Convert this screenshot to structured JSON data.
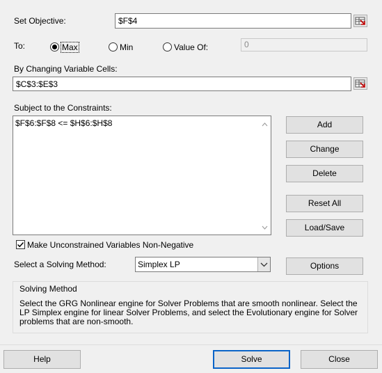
{
  "objective": {
    "label": "Set Objective:",
    "mnemonic": "b",
    "value": "$F$4"
  },
  "to": {
    "label": "To:",
    "options": [
      {
        "label": "Max",
        "selected": true
      },
      {
        "label": "Min",
        "selected": false
      },
      {
        "label": "Value Of:",
        "selected": false
      }
    ],
    "value_of": "0"
  },
  "variables": {
    "label": "By Changing Variable Cells:",
    "value": "$C$3:$E$3"
  },
  "constraints": {
    "label": "Subject to the Constraints:",
    "items": [
      "$F$6:$F$8 <= $H$6:$H$8"
    ]
  },
  "buttons": {
    "add": "Add",
    "change": "Change",
    "delete": "Delete",
    "reset_all": "Reset All",
    "load_save": "Load/Save",
    "options": "Options"
  },
  "nonneg": {
    "label": "Make Unconstrained Variables Non-Negative",
    "checked": true
  },
  "method": {
    "label": "Select a Solving Method:",
    "selected": "Simplex LP"
  },
  "solving_method": {
    "title": "Solving Method",
    "description": "Select the GRG Nonlinear engine for Solver Problems that are smooth nonlinear. Select the LP Simplex engine for linear Solver Problems, and select the Evolutionary engine for Solver problems that are non-smooth."
  },
  "footer": {
    "help": "Help",
    "solve": "Solve",
    "close": "Close"
  }
}
